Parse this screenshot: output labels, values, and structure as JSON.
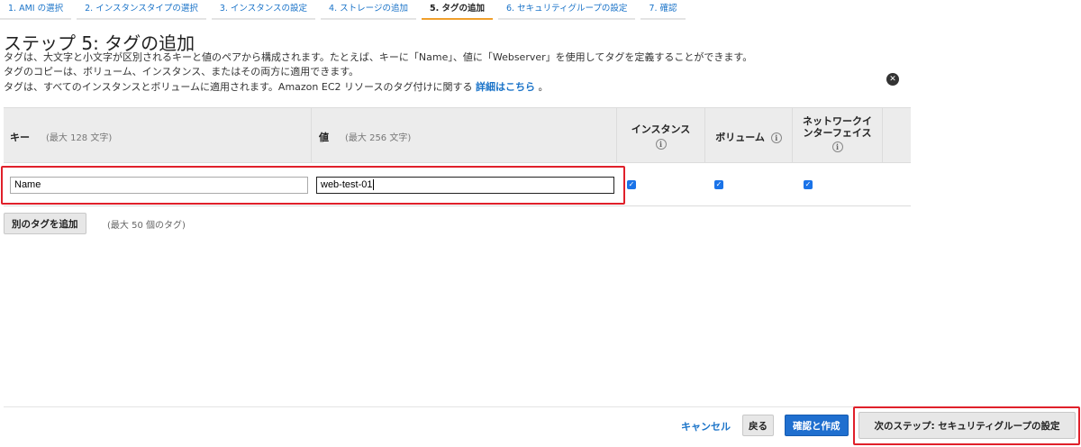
{
  "steps": [
    {
      "label": "1. AMI の選択",
      "active": false
    },
    {
      "label": "2. インスタンスタイプの選択",
      "active": false
    },
    {
      "label": "3. インスタンスの設定",
      "active": false
    },
    {
      "label": "4. ストレージの追加",
      "active": false
    },
    {
      "label": "5. タグの追加",
      "active": true
    },
    {
      "label": "6. セキュリティグループの設定",
      "active": false
    },
    {
      "label": "7. 確認",
      "active": false
    }
  ],
  "page": {
    "title": "ステップ 5: タグの追加",
    "desc1": "タグは、大文字と小文字が区別されるキーと値のペアから構成されます。たとえば、キーに「Name」、値に「Webserver」を使用してタグを定義することができます。",
    "desc2": "タグのコピーは、ボリューム、インスタンス、またはその両方に適用できます。",
    "desc3_text": "タグは、すべてのインスタンスとボリュームに適用されます。Amazon EC2 リソースのタグ付けに関する",
    "desc3_link": "詳細はこちら",
    "desc3_end": "。"
  },
  "table": {
    "headers": {
      "key": "キー",
      "key_hint": "(最大 128 文字)",
      "value": "値",
      "value_hint": "(最大 256 文字)",
      "instances": "インスタンス",
      "volumes": "ボリューム",
      "network_line1": "ネットワークイ",
      "network_line2": "ンターフェイス"
    },
    "rows": [
      {
        "key": "Name",
        "value": "web-test-01",
        "instances": true,
        "volumes": true,
        "network": true
      }
    ]
  },
  "actions": {
    "add_tag": "別のタグを追加",
    "max_tags": "(最大 50 個のタグ)",
    "cancel": "キャンセル",
    "back": "戻る",
    "review_launch": "確認と作成",
    "next": "次のステップ: セキュリティグループの設定"
  },
  "icons": {
    "info": "info-icon",
    "remove": "remove-circle-icon",
    "check": "checkbox-checked-icon"
  },
  "colors": {
    "link": "#1a73c8",
    "active_step_underline": "#f0a02c",
    "primary_button": "#1f6fcf",
    "highlight": "#e0202a"
  }
}
